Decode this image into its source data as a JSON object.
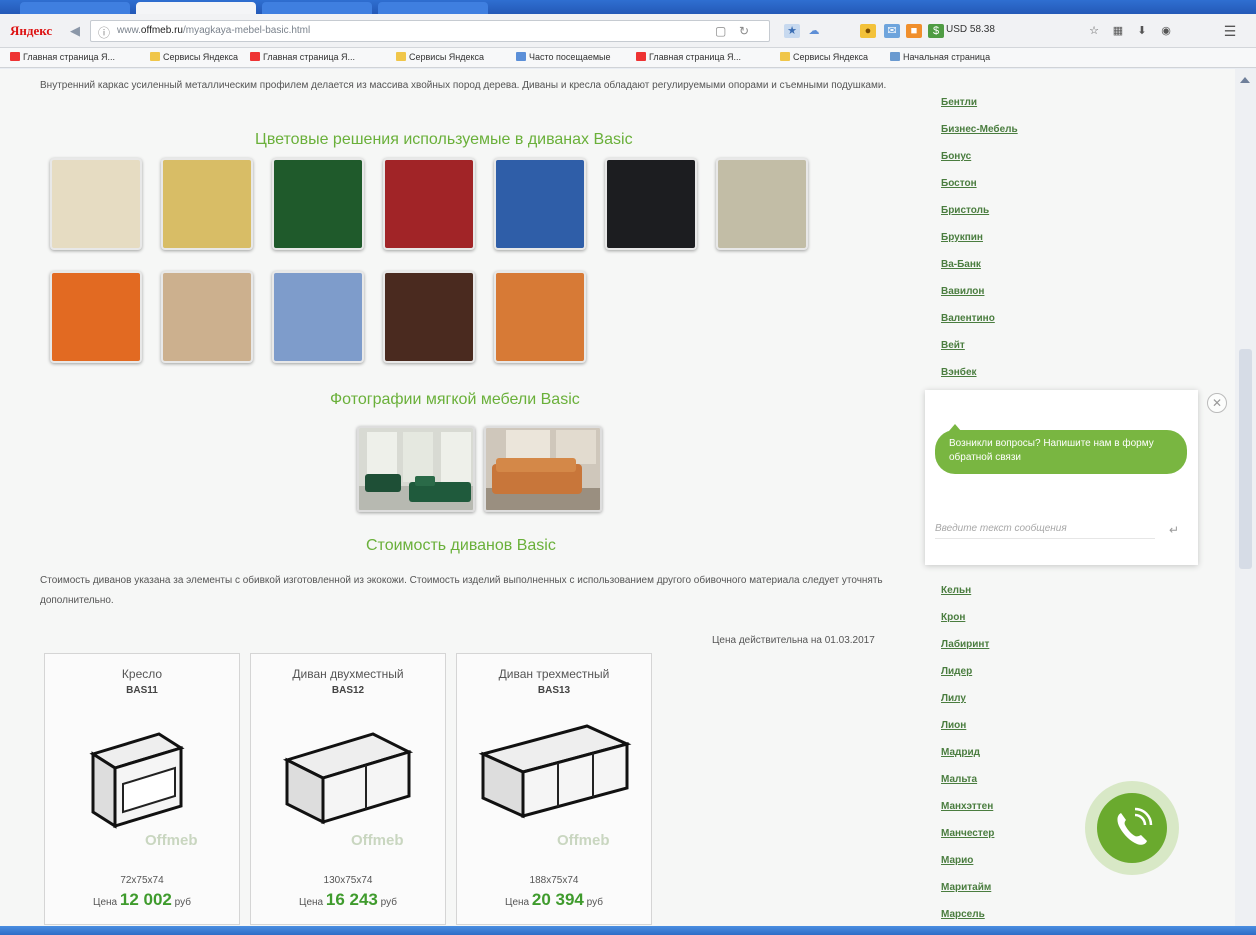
{
  "browser": {
    "logo": "Яндекс",
    "url_prefix": "www.",
    "url_domain": "offmeb.ru",
    "url_path": "/myagkaya-mebel-basic.html",
    "currency": "USD 58.38",
    "bookmarks": [
      "Главная страница Я...",
      "Сервисы Яндекса",
      "Главная страница Я...",
      "Сервисы Яндекса",
      "Часто посещаемые",
      "Главная страница Я...",
      "Сервисы Яндекса",
      "Начальная страница"
    ]
  },
  "main": {
    "intro_text": "Внутренний каркас усиленный металлическим профилем делается из массива хвойных пород дерева. Диваны и кресла обладают регулируемыми опорами и съемными подушками.",
    "colors_title": "Цветовые решения используемые в диванах Basic",
    "swatches": [
      "#e6dcc2",
      "#d8bd66",
      "#1f5a2b",
      "#a12427",
      "#2f5ea8",
      "#1c1d20",
      "#c2bda6",
      "#e26a22",
      "#ccb08e",
      "#7e9ccb",
      "#4a2a1f",
      "#d77a36"
    ],
    "photos_title": "Фотографии мягкой мебели Basic",
    "cost_title": "Стоимость диванов Basic",
    "cost_text": "Стоимость диванов указана за элементы с обивкой изготовленной из экокожи. Стоимость изделий выполненных с использованием другого обивочного материала следует уточнять дополнительно.",
    "price_valid": "Цена действительна на 01.03.2017",
    "watermark": "Offmeb",
    "price_prefix": "Цена",
    "price_suffix": "руб",
    "products": [
      {
        "name": "Кресло",
        "code": "BAS11",
        "dims": "72х75х74",
        "price": "12 002"
      },
      {
        "name": "Диван двухместный",
        "code": "BAS12",
        "dims": "130х75х74",
        "price": "16 243"
      },
      {
        "name": "Диван трехместный",
        "code": "BAS13",
        "dims": "188х75х74",
        "price": "20 394"
      }
    ]
  },
  "sidebar": {
    "top_brands": [
      "Бентли",
      "Бизнес-Мебель",
      "Бонус",
      "Бостон",
      "Бристоль",
      "Брукпин",
      "Ва-Банк",
      "Вавилон",
      "Валентино",
      "Вейт",
      "Вэнбек"
    ],
    "bottom_brands": [
      "Кельн",
      "Крон",
      "Лабиринт",
      "Лидер",
      "Лилу",
      "Лион",
      "Мадрид",
      "Мальта",
      "Манхэттен",
      "Манчестер",
      "Марио",
      "Маритайм",
      "Марсель"
    ]
  },
  "chat": {
    "message": "Возникли вопросы? Напишите нам в форму обратной связи",
    "placeholder": "Введите текст сообщения"
  },
  "colors": {
    "accent": "#6ab03a",
    "brand_link": "#4a7d3f",
    "chat_green": "#79b641"
  }
}
